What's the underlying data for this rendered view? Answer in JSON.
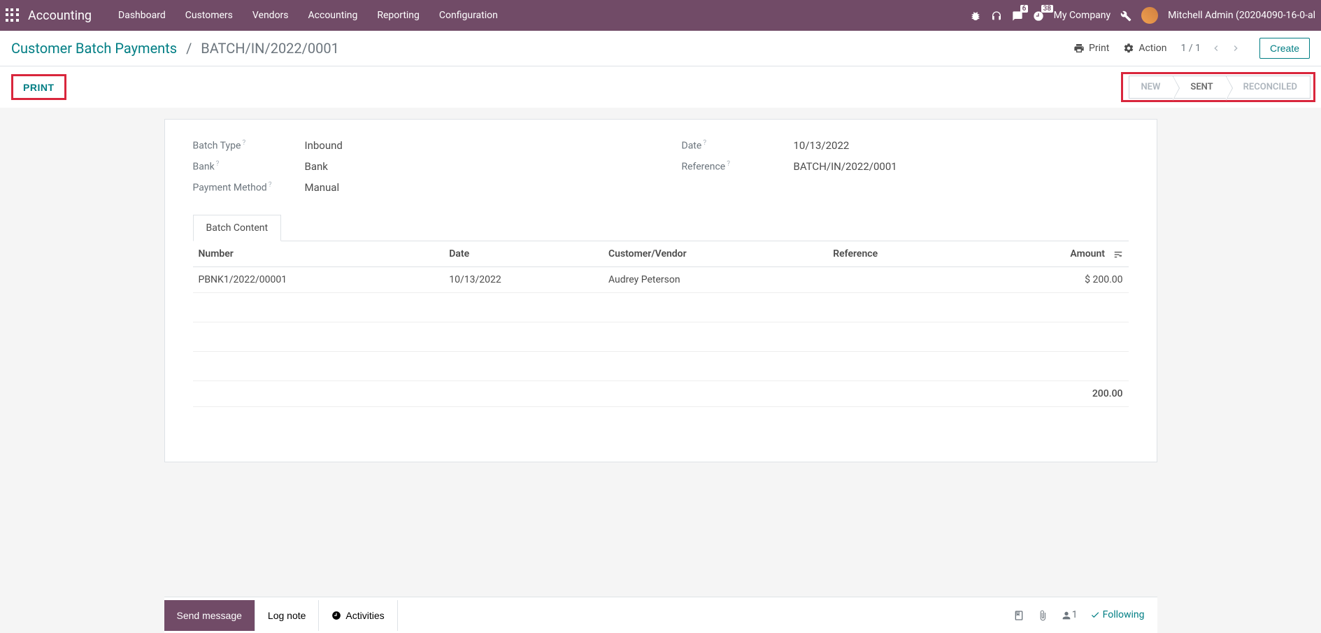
{
  "topnav": {
    "brand": "Accounting",
    "menu": [
      "Dashboard",
      "Customers",
      "Vendors",
      "Accounting",
      "Reporting",
      "Configuration"
    ],
    "messages_badge": "6",
    "activities_badge": "38",
    "company": "My Company",
    "user": "Mitchell Admin (20204090-16-0-al"
  },
  "cp": {
    "breadcrumb_root": "Customer Batch Payments",
    "breadcrumb_current": "BATCH/IN/2022/0001",
    "print": "Print",
    "action": "Action",
    "pager": "1 / 1",
    "create": "Create"
  },
  "statusbar": {
    "print": "PRINT",
    "steps": [
      "NEW",
      "SENT",
      "RECONCILED"
    ],
    "active_step": "SENT"
  },
  "form": {
    "left": [
      {
        "label": "Batch Type",
        "help": true,
        "value": "Inbound"
      },
      {
        "label": "Bank",
        "help": true,
        "value": "Bank"
      },
      {
        "label": "Payment Method",
        "help": true,
        "value": "Manual"
      }
    ],
    "right": [
      {
        "label": "Date",
        "help": true,
        "value": "10/13/2022"
      },
      {
        "label": "Reference",
        "help": true,
        "value": "BATCH/IN/2022/0001"
      }
    ]
  },
  "tab": "Batch Content",
  "table": {
    "headers": [
      "Number",
      "Date",
      "Customer/Vendor",
      "Reference",
      "Amount"
    ],
    "rows": [
      {
        "number": "PBNK1/2022/00001",
        "date": "10/13/2022",
        "partner": "Audrey Peterson",
        "reference": "",
        "amount": "$ 200.00"
      }
    ],
    "total": "200.00"
  },
  "chatter": {
    "send": "Send message",
    "log": "Log note",
    "activities": "Activities",
    "followers": "1",
    "following": "Following"
  }
}
